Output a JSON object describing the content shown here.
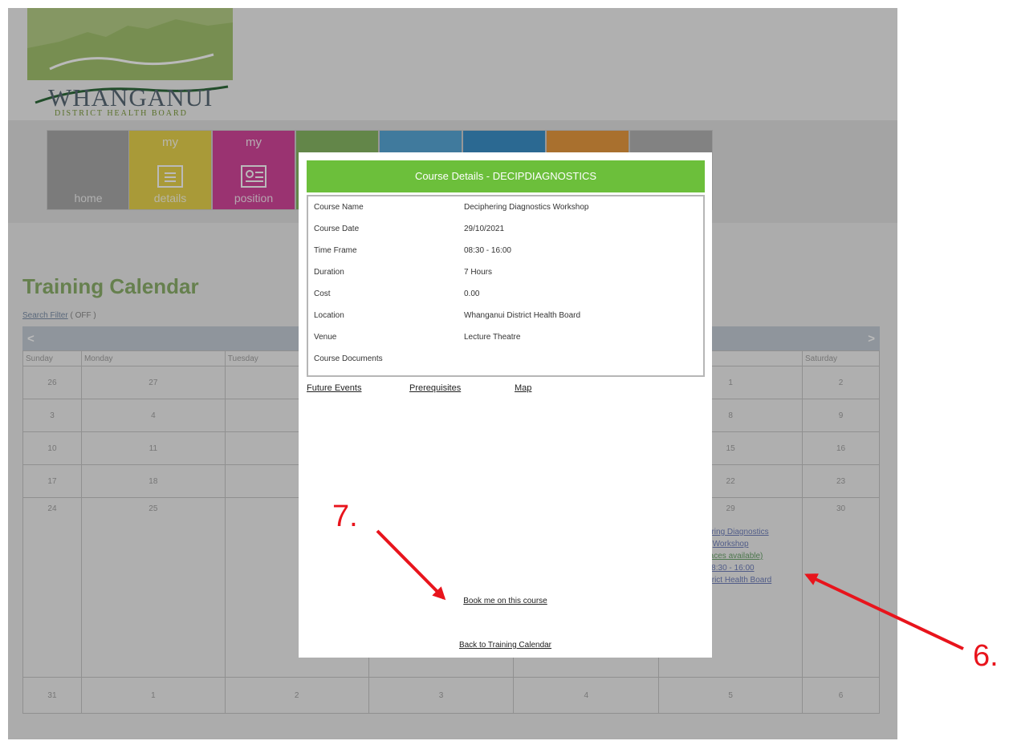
{
  "logo": {
    "word": "WHANGANUI",
    "sub": "DISTRICT HEALTH BOARD"
  },
  "nav": [
    {
      "top": "",
      "label": "home",
      "color": "#a9a9a9"
    },
    {
      "top": "my",
      "label": "details",
      "color": "#e8d44d"
    },
    {
      "top": "my",
      "label": "position",
      "color": "#d4469b"
    },
    {
      "top": "",
      "label": "",
      "color": "#88b864"
    },
    {
      "top": "",
      "label": "",
      "color": "#58a8d8"
    },
    {
      "top": "",
      "label": "",
      "color": "#3c90c8"
    },
    {
      "top": "",
      "label": "",
      "color": "#e89a40"
    },
    {
      "top": "",
      "label": "",
      "color": "#b2b2b2"
    }
  ],
  "page": {
    "title": "Training Calendar",
    "filter_link": "Search Filter",
    "filter_state": " ( OFF )"
  },
  "calendar": {
    "prev": "<",
    "next": ">",
    "days": [
      "Sunday",
      "Monday",
      "Tuesday",
      "",
      "",
      "",
      "Saturday"
    ],
    "weeks": [
      [
        "26",
        "27",
        "",
        "",
        "",
        "1",
        "2"
      ],
      [
        "3",
        "4",
        "",
        "",
        "",
        "8",
        "9"
      ],
      [
        "10",
        "11",
        "",
        "",
        "",
        "15",
        "16"
      ],
      [
        "17",
        "18",
        "",
        "",
        "",
        "22",
        "23"
      ],
      [
        "24",
        "25",
        "",
        "",
        "",
        "29",
        "30"
      ],
      [
        "31",
        "1",
        "2",
        "3",
        "4",
        "5",
        "6"
      ]
    ],
    "event": {
      "line1": "ciphering Diagnostics",
      "line2": "Workshop",
      "line3": "(spaces available)",
      "line4": "08:30 - 16:00",
      "line5": "ui District Health Board"
    }
  },
  "modal": {
    "header": "Course Details - DECIPDIAGNOSTICS",
    "rows": [
      {
        "label": "Course Name",
        "value": "Deciphering Diagnostics Workshop"
      },
      {
        "label": "Course Date",
        "value": "29/10/2021"
      },
      {
        "label": "Time Frame",
        "value": "08:30 - 16:00"
      },
      {
        "label": "Duration",
        "value": "7 Hours"
      },
      {
        "label": "Cost",
        "value": "0.00"
      },
      {
        "label": "Location",
        "value": "Whanganui District Health Board"
      },
      {
        "label": "Venue",
        "value": "Lecture Theatre"
      },
      {
        "label": "Course Documents",
        "value": ""
      }
    ],
    "links": {
      "future": "Future Events",
      "prereq": "Prerequisites",
      "map": "Map"
    },
    "book": "Book me on this course",
    "back": "Back to Training Calendar"
  },
  "annotations": {
    "seven": "7.",
    "six": "6.",
    "color": "#e8141c"
  }
}
